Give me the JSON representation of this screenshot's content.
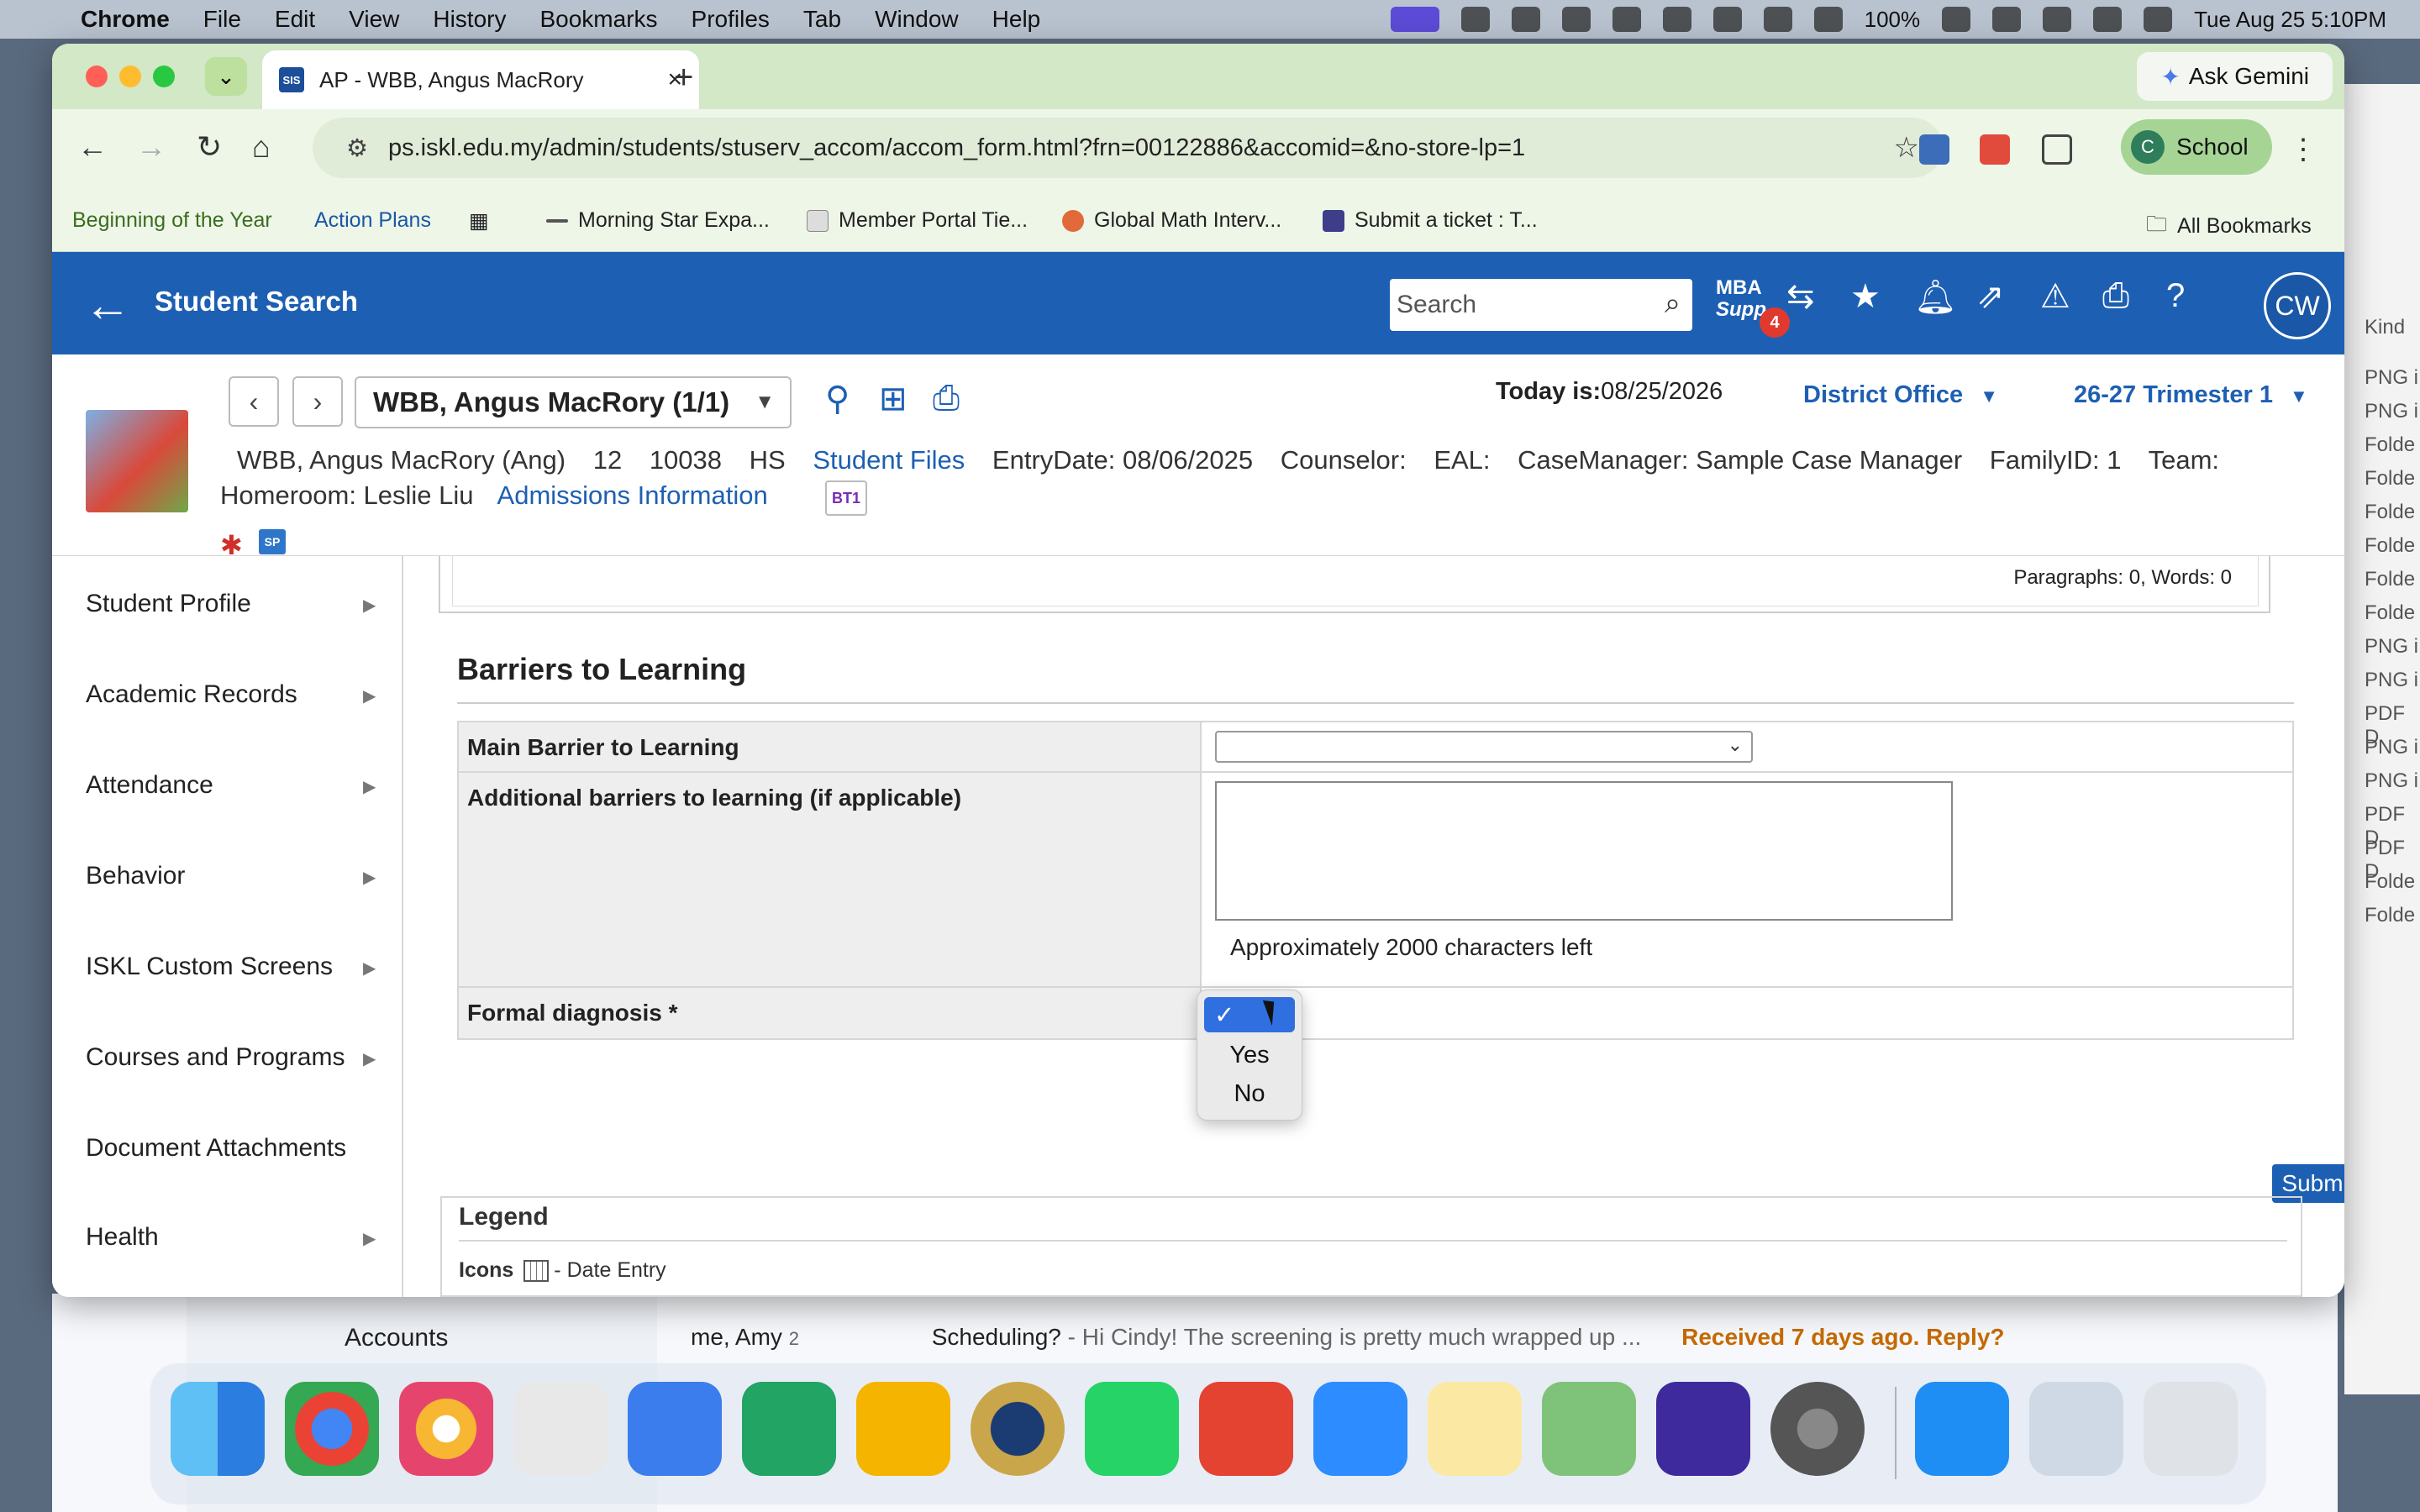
{
  "menubar": {
    "app": "Chrome",
    "items": [
      "File",
      "Edit",
      "View",
      "History",
      "Bookmarks",
      "Profiles",
      "Tab",
      "Window",
      "Help"
    ],
    "battery": "100%",
    "datetime": "Tue Aug 25  5:10PM"
  },
  "browser": {
    "tab_title": "AP - WBB, Angus MacRory",
    "tab_favicon": "SIS",
    "ask_gemini": "Ask Gemini",
    "url": "ps.iskl.edu.my/admin/students/stuserv_accom/accom_form.html?frn=00122886&accomid=&no-store-lp=1",
    "profile_initial": "C",
    "profile_name": "School",
    "bookmarks": [
      "Beginning of the Year",
      "Action Plans",
      "Morning Star Expa...",
      "Member Portal Tie...",
      "Global Math Interv...",
      "Submit a ticket : T..."
    ],
    "all_bookmarks": "All Bookmarks"
  },
  "header": {
    "title": "Student Search",
    "search_placeholder": "Search",
    "mba_line1": "MBA",
    "mba_line2": "Supp",
    "mba_badge": "4",
    "user_initials": "CW"
  },
  "student": {
    "selector": "WBB, Angus MacRory  (1/1)",
    "today_label": "Today is:",
    "today_value": "08/25/2026",
    "district": "District Office",
    "term": "26-27 Trimester 1",
    "name": "WBB, Angus MacRory (Ang)",
    "grade": "12",
    "id": "10038",
    "school": "HS",
    "files_link": "Student Files",
    "entry": "EntryDate: 08/06/2025",
    "counselor": "Counselor:",
    "eal": "EAL:",
    "casemanager": "CaseManager: Sample Case Manager",
    "familyid": "FamilyID: 1",
    "team": "Team:",
    "homeroom": "Homeroom: Leslie Liu",
    "admissions_link": "Admissions Information",
    "bt1": "BT1",
    "sp": "SP"
  },
  "nav": {
    "items": [
      {
        "label": "Student Profile",
        "arrow": true
      },
      {
        "label": "Academic Records",
        "arrow": true
      },
      {
        "label": "Attendance",
        "arrow": true
      },
      {
        "label": "Behavior",
        "arrow": true
      },
      {
        "label": "ISKL Custom Screens",
        "arrow": true
      },
      {
        "label": "Courses and Programs",
        "arrow": true
      },
      {
        "label": "Document Attachments",
        "arrow": false
      },
      {
        "label": "Health",
        "arrow": true
      }
    ]
  },
  "form": {
    "editor_status": "Paragraphs: 0, Words: 0",
    "section_title": "Barriers to Learning",
    "main_barrier_label": "Main Barrier to Learning",
    "additional_label": "Additional barriers to learning (if applicable)",
    "chars_left": "Approximately 2000 characters left",
    "formal_label": "Formal diagnosis *",
    "dropdown_options": [
      "",
      "Yes",
      "No"
    ],
    "dropdown_selected_check": "✓",
    "submit": "Submit"
  },
  "legend": {
    "title": "Legend",
    "icons_label": "Icons",
    "date_entry": "- Date Entry"
  },
  "background": {
    "mail_folder": "Accounts",
    "mail_from": "me, Amy",
    "mail_count": "2",
    "mail_subject": "Scheduling?",
    "mail_snippet": " - Hi Cindy! The screening is pretty much wrapped up ...",
    "mail_status": "Received 7 days ago. Reply?",
    "finder_rows": [
      "PNG i",
      "PNG i",
      "Folde",
      "Folde",
      "Folde",
      "Folde",
      "Folde",
      "Folde",
      "PNG i",
      "PNG i",
      "PDF D",
      "PNG i",
      "PNG i",
      "PDF D",
      "PDF D",
      "Folde",
      "Folde"
    ],
    "finder_kind": "Kind"
  },
  "colors": {
    "ps_blue": "#1d5fb3",
    "chrome_green": "#d3e8c7",
    "select_blue": "#2f6fe0"
  }
}
